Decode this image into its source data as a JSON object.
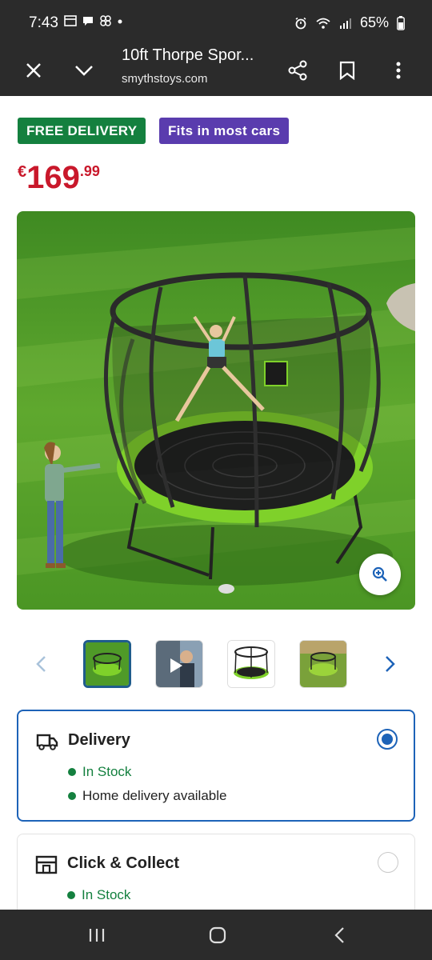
{
  "status_bar": {
    "time": "7:43",
    "left_icons": [
      "calendar-icon",
      "chat-icon",
      "pinwheel-icon",
      "dot-icon"
    ],
    "right_icons": [
      "alarm-icon",
      "wifi-icon",
      "signal-icon"
    ],
    "battery": "65%"
  },
  "toolbar": {
    "title": "10ft Thorpe Spor...",
    "url": "smythstoys.com",
    "icons": [
      "close-icon",
      "chevron-down-icon",
      "share-icon",
      "bookmark-icon",
      "more-icon"
    ]
  },
  "badges": {
    "delivery": "FREE DELIVERY",
    "cars": "Fits in most cars"
  },
  "price": {
    "currency": "€",
    "whole": "169",
    "cents": ".99",
    "color": "#c9182b"
  },
  "gallery": {
    "thumbnails": [
      "trampoline-lawn",
      "video-person",
      "trampoline-white",
      "trampoline-garden"
    ],
    "active_index": 0
  },
  "delivery": {
    "title": "Delivery",
    "status": "In Stock",
    "note": "Home delivery available",
    "selected": true
  },
  "collect": {
    "title": "Click & Collect",
    "status": "In Stock",
    "selected": false
  },
  "colors": {
    "green": "#14803f",
    "purple": "#5a3cae",
    "blue": "#1d63b8",
    "dark_bar": "#2b2b2b"
  }
}
